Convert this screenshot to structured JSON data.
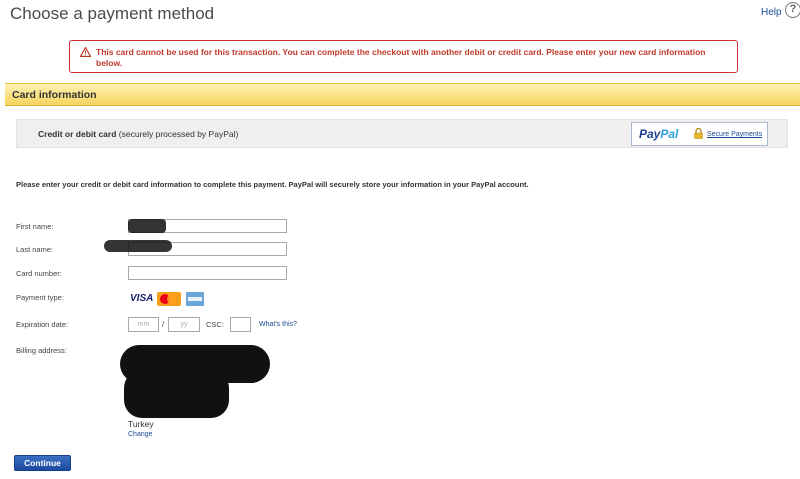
{
  "header": {
    "title": "Choose a payment method",
    "help_label": "Help",
    "help_icon": "question-circle-icon"
  },
  "error": {
    "icon": "warning-triangle-icon",
    "message": "This card cannot be used for this transaction. You can complete the checkout with another debit or credit card. Please enter your new card information below.",
    "color": "#c0392b"
  },
  "section": {
    "title": "Card information",
    "accent": "#f6d35e"
  },
  "method": {
    "label_bold": "Credit or debit card",
    "label_rest": "(securely processed by PayPal)",
    "logo_pay": "Pay",
    "logo_pal": "Pal",
    "secure_label": "Secure Payments"
  },
  "form": {
    "instructions": "Please enter your credit or debit card information to complete this payment. PayPal will securely store your information in your PayPal account.",
    "first_name_label": "First name:",
    "last_name_label": "Last name:",
    "card_number_label": "Card number:",
    "payment_type_label": "Payment type:",
    "payment_types": [
      "VISA",
      "MasterCard",
      "American Express"
    ],
    "expiration_label": "Expiration date:",
    "month_placeholder": "mm",
    "year_placeholder": "yy",
    "slash": "/",
    "csc_label": "CSC:",
    "whats_this": "What's this?",
    "billing_label": "Billing address:",
    "country": "Turkey",
    "change_label": "Change",
    "continue_label": "Continue"
  }
}
